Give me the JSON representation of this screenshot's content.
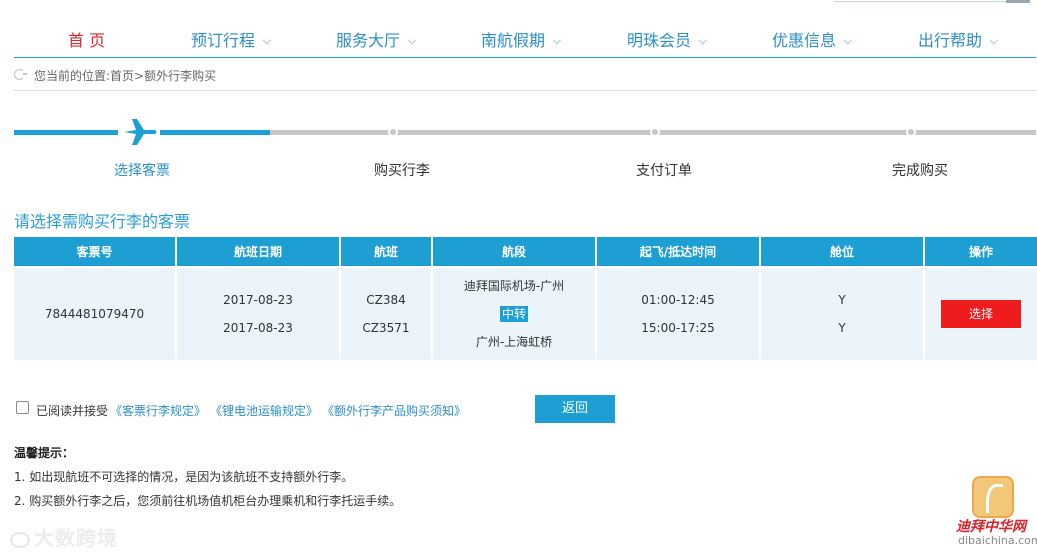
{
  "nav": {
    "items": [
      {
        "label": "首 页",
        "has_dropdown": false,
        "active": true
      },
      {
        "label": "预订行程",
        "has_dropdown": true,
        "active": false
      },
      {
        "label": "服务大厅",
        "has_dropdown": true,
        "active": false
      },
      {
        "label": "南航假期",
        "has_dropdown": true,
        "active": false
      },
      {
        "label": "明珠会员",
        "has_dropdown": true,
        "active": false
      },
      {
        "label": "优惠信息",
        "has_dropdown": true,
        "active": false
      },
      {
        "label": "出行帮助",
        "has_dropdown": true,
        "active": false
      }
    ]
  },
  "breadcrumb": {
    "text": "您当前的位置:首页>额外行李购买"
  },
  "steps": {
    "items": [
      {
        "label": "选择客票",
        "state": "current"
      },
      {
        "label": "购买行李",
        "state": "pending"
      },
      {
        "label": "支付订单",
        "state": "pending"
      },
      {
        "label": "完成购买",
        "state": "pending"
      }
    ],
    "active_color": "#1d9fd3",
    "inactive_color": "#c6c6c6",
    "icon": "airplane-icon"
  },
  "section": {
    "title": "请选择需购买行李的客票"
  },
  "table": {
    "headers": [
      "客票号",
      "航班日期",
      "航班",
      "航段",
      "起飞/抵达时间",
      "舱位",
      "操作"
    ],
    "row": {
      "ticket_no": "7844481079470",
      "dates": [
        "2017-08-23",
        "2017-08-23"
      ],
      "flights": [
        "CZ384",
        "CZ3571"
      ],
      "segments": [
        "迪拜国际机场-广州",
        "中转",
        "广州-上海虹桥"
      ],
      "times": [
        "01:00-12:45",
        "15:00-17:25"
      ],
      "cabins": [
        "Y",
        "Y"
      ],
      "action_label": "选择"
    }
  },
  "agree": {
    "prefix": "已阅读并接受",
    "links": [
      "《客票行李规定》",
      "《锂电池运输规定》",
      "《额外行李产品购买须知》"
    ]
  },
  "back_button": "返回",
  "tips": {
    "title": "温馨提示：",
    "items": [
      "1. 如出现航班不可选择的情况，是因为该航班不支持额外行李。",
      "2. 购买额外行李之后，您须前往机场值机柜台办理乘机和行李托运手续。"
    ]
  },
  "watermarks": {
    "left": "大数跨境",
    "right_cn": "迪拜中华网",
    "right_en": "dibaichina.com"
  },
  "colors": {
    "brand_blue": "#1d9fd3",
    "active_red": "#e0262b",
    "select_red": "#ee1c1c"
  }
}
